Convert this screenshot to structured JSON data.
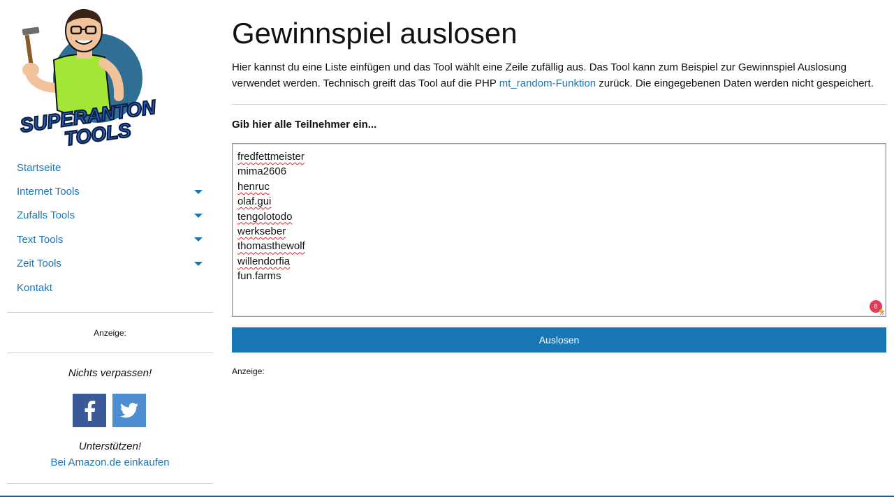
{
  "logo": {
    "text_line1": "SUPERANTON",
    "text_line2": "TOOLS"
  },
  "nav": [
    {
      "label": "Startseite",
      "has_submenu": false
    },
    {
      "label": "Internet Tools",
      "has_submenu": true
    },
    {
      "label": "Zufalls Tools",
      "has_submenu": true
    },
    {
      "label": "Text Tools",
      "has_submenu": true
    },
    {
      "label": "Zeit Tools",
      "has_submenu": true
    },
    {
      "label": "Kontakt",
      "has_submenu": false
    }
  ],
  "sidebar": {
    "ad_label": "Anzeige:",
    "follow_heading": "Nichts verpassen!",
    "support_heading": "Unterstützen!",
    "amazon_link": "Bei Amazon.de einkaufen"
  },
  "main": {
    "title": "Gewinnspiel auslosen",
    "desc_part1": "Hier kannst du eine Liste einfügen und das Tool wählt eine Zeile zufällig aus. Das Tool kann zum Beispiel zur Gewinnspiel Auslosung verwendet werden. Technisch greift das Tool auf die PHP ",
    "desc_link": "mt_random-Funktion",
    "desc_part2": " zurück. Die eingegebenen Daten werden nicht gespeichert.",
    "prompt": "Gib hier alle Teilnehmer ein...",
    "participants": [
      {
        "name": "fredfettmeister",
        "spellcheck_flag": true
      },
      {
        "name": "mima2606",
        "spellcheck_flag": false
      },
      {
        "name": "henruc",
        "spellcheck_flag": true
      },
      {
        "name": "olaf.gui",
        "spellcheck_flag": true
      },
      {
        "name": "tengolotodo",
        "spellcheck_flag": true
      },
      {
        "name": "werkseber",
        "spellcheck_flag": true
      },
      {
        "name": "thomasthewolf",
        "spellcheck_flag": true
      },
      {
        "name": "willendorfia",
        "spellcheck_flag": true
      },
      {
        "name": "fun.farms",
        "spellcheck_flag": false
      }
    ],
    "extension_badge": "8",
    "button_label": "Auslosen",
    "ad_label": "Anzeige:"
  },
  "colors": {
    "link": "#1a77b6",
    "button": "#1a77b6",
    "facebook": "#3b5998",
    "twitter": "#4d8ed0"
  },
  "icons": [
    "hammer-icon",
    "facebook-icon",
    "twitter-icon",
    "caret-down-icon"
  ]
}
